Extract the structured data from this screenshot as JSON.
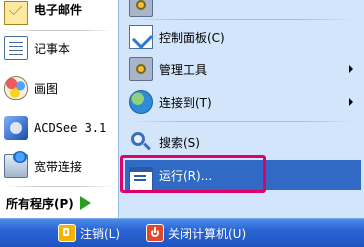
{
  "left_menu": {
    "items": [
      {
        "label": "电子邮件",
        "icon": "mail-icon",
        "bold": true
      },
      {
        "label": "记事本",
        "icon": "notepad-icon",
        "bold": false
      },
      {
        "label": "画图",
        "icon": "paint-icon",
        "bold": false
      },
      {
        "label": "ACDSee 3.1",
        "icon": "acdsee-icon",
        "bold": false
      },
      {
        "label": "宽带连接",
        "icon": "broadband-connection-icon",
        "bold": false
      }
    ],
    "all_programs": {
      "label": "所有程序(P)",
      "icon": "green-arrow-icon"
    }
  },
  "right_menu": {
    "items": [
      {
        "label": "控制面板(C)",
        "icon": "control-panel-icon",
        "has_submenu": false
      },
      {
        "label": "管理工具",
        "icon": "admin-tools-icon",
        "has_submenu": true
      },
      {
        "label": "连接到(T)",
        "icon": "connect-to-icon",
        "has_submenu": true
      },
      {
        "label": "搜索(S)",
        "icon": "search-icon",
        "has_submenu": false
      },
      {
        "label": "运行(R)...",
        "icon": "run-icon",
        "has_submenu": false,
        "selected": true
      }
    ]
  },
  "bottom_bar": {
    "logoff": {
      "label": "注销(L)",
      "icon": "logoff-icon"
    },
    "shutdown": {
      "label": "关闭计算机(U)",
      "icon": "shutdown-icon"
    }
  },
  "colors": {
    "left_background": "#ffffff",
    "right_background": "#d3e5fa",
    "selection": "#316ac5",
    "highlight_border": "#e0006a",
    "bottom_bar": "#2a63d3"
  }
}
